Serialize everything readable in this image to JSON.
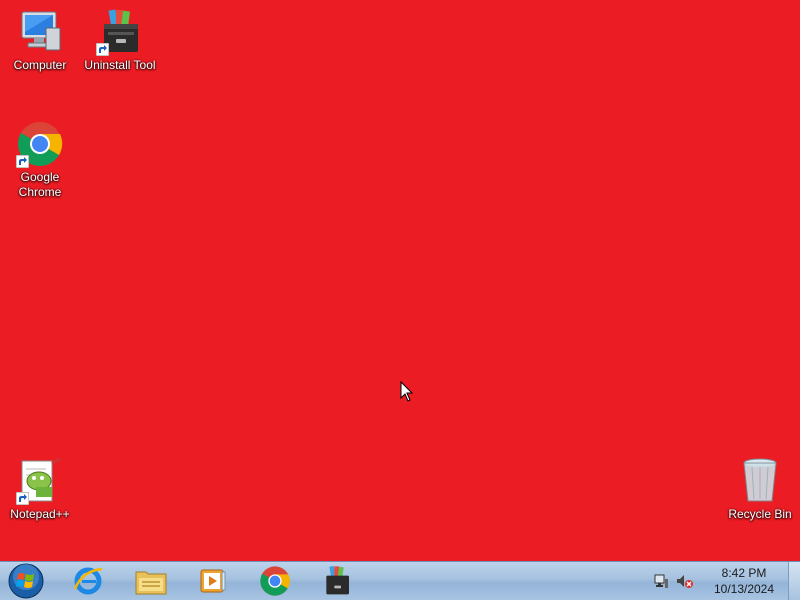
{
  "desktop": {
    "background_color": "#ec1c24",
    "icons": [
      {
        "label": "Computer",
        "icon": "computer-icon"
      },
      {
        "label": "Uninstall Tool",
        "icon": "uninstall-tool-icon"
      },
      {
        "label": "Google\nChrome",
        "icon": "chrome-icon"
      },
      {
        "label": "Notepad++",
        "icon": "notepad-plus-plus-icon"
      },
      {
        "label": "Recycle Bin",
        "icon": "recycle-bin-icon"
      }
    ]
  },
  "taskbar": {
    "start_icon": "windows-start-orb-icon",
    "pinned": [
      {
        "icon": "internet-explorer-icon"
      },
      {
        "icon": "file-explorer-icon"
      },
      {
        "icon": "media-player-icon"
      },
      {
        "icon": "chrome-icon"
      },
      {
        "icon": "uninstall-tool-icon"
      }
    ],
    "tray": {
      "network_icon": "network-icon",
      "volume_icon": "volume-muted-icon"
    },
    "clock": {
      "time": "8:42 PM",
      "date": "10/13/2024"
    }
  }
}
